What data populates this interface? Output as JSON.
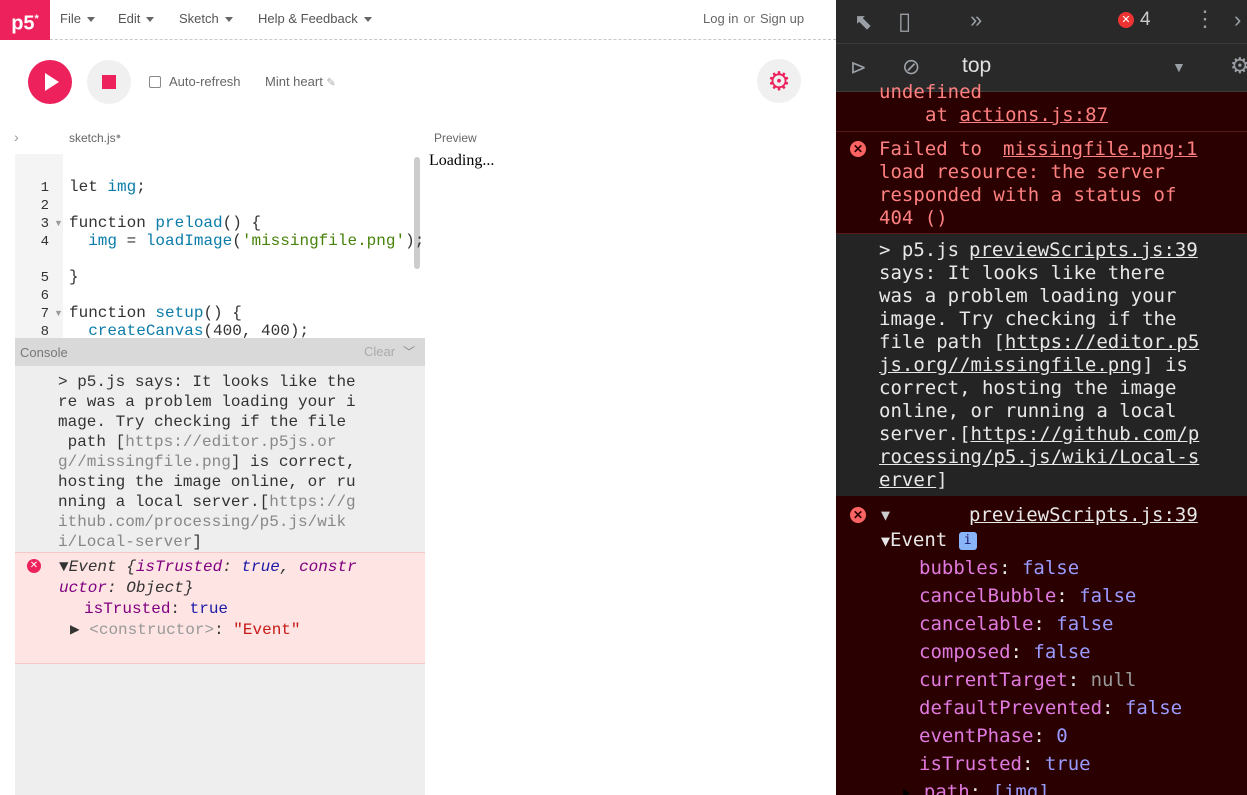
{
  "editor": {
    "logo": "p5",
    "logo_sup": "*",
    "menu": {
      "file": "File",
      "edit": "Edit",
      "sketch": "Sketch",
      "help": "Help & Feedback"
    },
    "auth": {
      "login": "Log in",
      "or": "or",
      "signup": "Sign up"
    },
    "toolbar": {
      "auto_refresh": "Auto-refresh",
      "sketch_name": "Mint heart"
    },
    "tab_name": "sketch.js",
    "preview_label": "Preview",
    "preview_text": "Loading...",
    "code_lines": [
      {
        "n": "1",
        "text": "let img;"
      },
      {
        "n": "2",
        "text": ""
      },
      {
        "n": "3",
        "text": "function preload() {"
      },
      {
        "n": "4",
        "text": "  img = loadImage('missingfile.png');"
      },
      {
        "n": "5",
        "text": "}"
      },
      {
        "n": "6",
        "text": ""
      },
      {
        "n": "7",
        "text": "function setup() {"
      },
      {
        "n": "8",
        "text": "  createCanvas(400, 400);"
      }
    ],
    "console": {
      "label": "Console",
      "clear": "Clear",
      "message_lines": [
        "> p5.js says: It looks like the",
        "re was a problem loading your i",
        "mage. Try checking if the file",
        " path [https://editor.p5js.or",
        "g//missingfile.png] is correct,",
        "hosting the image online, or ru",
        "nning a local server.[https://g",
        "ithub.com/processing/p5.js/wik",
        "i/Local-server]"
      ],
      "error_lines": [
        "Event {isTrusted: true, constr",
        "uctor: Object}"
      ],
      "is_trusted_key": "isTrusted",
      "is_trusted_val": "true",
      "constructor_key": "<constructor>",
      "constructor_val": "\"Event\""
    }
  },
  "devtools": {
    "error_count": "4",
    "context": "top",
    "msg0": {
      "line1": "undefined",
      "line2_prefix": "at ",
      "line2_link": "actions.js:87"
    },
    "msg1": {
      "text_lines": [
        "Failed to",
        "load resource: the server",
        "responded with a status of",
        "404 ()"
      ],
      "source": "missingfile.png:1"
    },
    "msg2": {
      "prefix": "> p5.js",
      "source": "previewScripts.js:39",
      "lines": [
        "says: It looks like there",
        "was a problem loading your",
        "image. Try checking if the",
        "file path [",
        "js.org//missingfile.png",
        "correct, hosting the image",
        "online, or running a local",
        "server.[",
        "rocessing/p5.js/wiki/Local-s",
        "erver"
      ],
      "link1a": "https://editor.p5",
      "link1b": "js.org//missingfile.png",
      "after_link1": "] is",
      "link2a": "https://github.com/p",
      "link2b": "rocessing/p5.js/wiki/Local-s",
      "link2c": "erver",
      "close": "]"
    },
    "msg3": {
      "source": "previewScripts.js:39",
      "event_label": "Event",
      "info": "i",
      "props": [
        {
          "k": "bubbles",
          "v": "false",
          "t": "val"
        },
        {
          "k": "cancelBubble",
          "v": "false",
          "t": "val"
        },
        {
          "k": "cancelable",
          "v": "false",
          "t": "val"
        },
        {
          "k": "composed",
          "v": "false",
          "t": "val"
        },
        {
          "k": "currentTarget",
          "v": "null",
          "t": "null"
        },
        {
          "k": "defaultPrevented",
          "v": "false",
          "t": "val"
        },
        {
          "k": "eventPhase",
          "v": "0",
          "t": "val"
        },
        {
          "k": "isTrusted",
          "v": "true",
          "t": "val"
        },
        {
          "k": "path",
          "v": "[img]",
          "t": "val"
        }
      ]
    }
  }
}
